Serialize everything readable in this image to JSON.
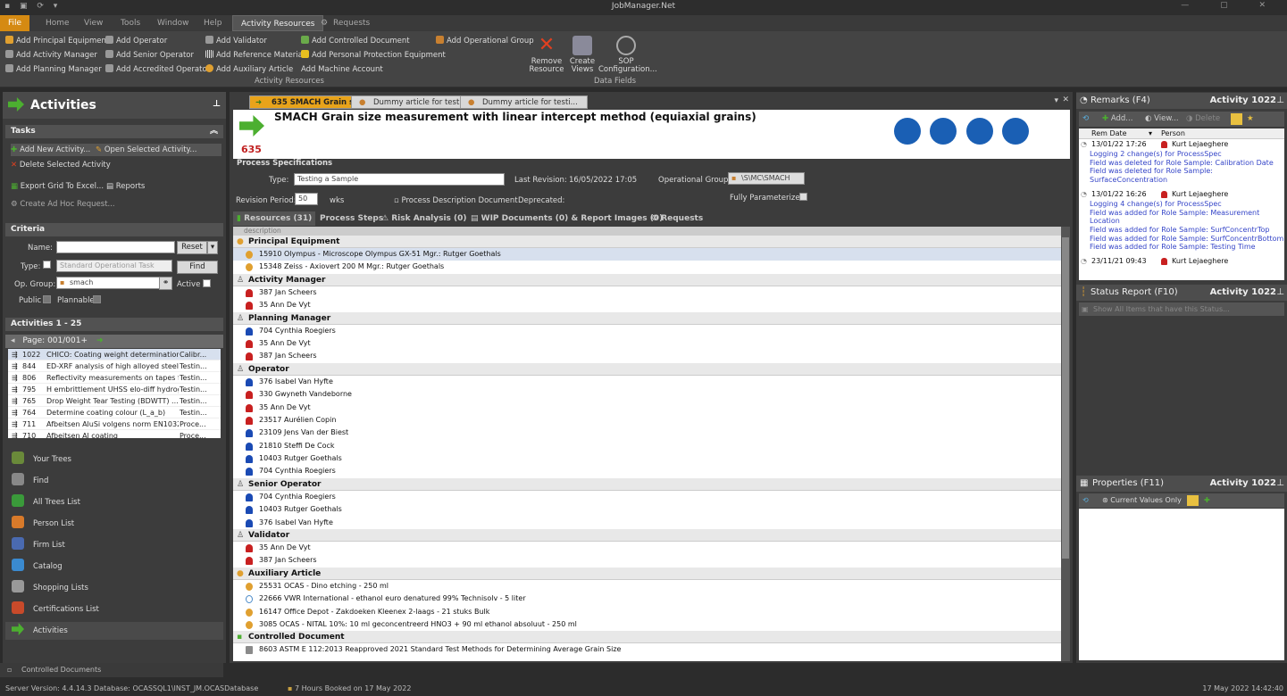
{
  "app": {
    "title": "JobManager.Net"
  },
  "menu": [
    "File",
    "Home",
    "View",
    "Tools",
    "Window",
    "Help",
    "Activity Resources",
    "Requests"
  ],
  "ribbon": {
    "col1": [
      "Add Principal Equipment",
      "Add Activity Manager",
      "Add Planning Manager"
    ],
    "col2": [
      "Add Operator",
      "Add Senior Operator",
      "Add Accredited Operator"
    ],
    "col3": [
      "Add Validator",
      "Add Reference Material",
      "Add Auxiliary Article"
    ],
    "col4": [
      "Add Controlled Document",
      "Add Personal Protection Equipment",
      "Add Machine Account"
    ],
    "col5": [
      "Add Operational Group"
    ],
    "remove": "Remove Resource",
    "create_views": "Create Views",
    "sop": "SOP Configuration...",
    "group_activity": "Activity Resources",
    "group_data": "Data Fields"
  },
  "left": {
    "title": "Activities",
    "tasks_label": "Tasks",
    "tasks": {
      "add_new": "Add New Activity...",
      "open_selected": "Open Selected Activity...",
      "delete_selected": "Delete Selected Activity",
      "export": "Export Grid To Excel...",
      "reports": "Reports",
      "create_adhoc": "Create Ad Hoc Request..."
    },
    "criteria_label": "Criteria",
    "criteria": {
      "name_label": "Name:",
      "reset": "Reset",
      "type_label": "Type:",
      "type_placeholder": "Standard Operational Task",
      "find": "Find",
      "opgroup_label": "Op. Group:",
      "opgroup_value": "smach",
      "active_label": "Active",
      "public_label": "Public",
      "plannable_label": "Plannable"
    },
    "activities_label": "Activities 1 - 25",
    "page": "Page: 001/001+",
    "activities": [
      {
        "id": "1022",
        "name": "CHICO: Coating weight determination ...",
        "type": "Calibr..."
      },
      {
        "id": "844",
        "name": "ED-XRF analysis of high alloyed steels",
        "type": "Testin..."
      },
      {
        "id": "806",
        "name": "Reflectivity measurements on tapes fr...",
        "type": "Testin..."
      },
      {
        "id": "795",
        "name": "H embrittlement UHSS elo-diff hydrog...",
        "type": "Testin..."
      },
      {
        "id": "765",
        "name": "Drop Weight Tear Testing (BDWTT) ...",
        "type": "Testin..."
      },
      {
        "id": "764",
        "name": "Determine coating colour (L_a_b)",
        "type": "Testin..."
      },
      {
        "id": "711",
        "name": "Afbeitsen AluSi volgens norm EN1032...",
        "type": "Proce..."
      },
      {
        "id": "710",
        "name": "Afbeitsen Al coating",
        "type": "Proce..."
      }
    ],
    "nav": [
      "Your Trees",
      "Find",
      "All Trees List",
      "Person List",
      "Firm List",
      "Catalog",
      "Shopping Lists",
      "Certifications List",
      "Activities"
    ]
  },
  "center": {
    "tabs": [
      "635 SMACH Grain si...",
      "Dummy article for testi...",
      "Dummy article for testi..."
    ],
    "doc_title": "SMACH Grain size measurement with linear intercept method (equiaxial grains)",
    "doc_id": "635",
    "process_specs": "Process Specifications",
    "type_label": "Type:",
    "type_value": "Testing a Sample",
    "last_revision_label": "Last Revision:",
    "last_revision_value": "16/05/2022 17:05",
    "opgroup_label": "Operational Group:",
    "opgroup_value": "\\S\\MC\\SMACH",
    "revision_period_label": "Revision Period:",
    "revision_period_value": "50",
    "wks": "wks",
    "process_desc": "Process Description Document",
    "deprecated": "Deprecated:",
    "fully_param": "Fully Parameterized:",
    "subtabs": [
      "Resources (31)",
      "Process Steps",
      "Risk Analysis (0)",
      "WIP Documents (0) & Report Images (0)",
      "Requests"
    ],
    "col_description": "description",
    "groups": [
      {
        "name": "Principal Equipment",
        "items": [
          "15910 Olympus - Microscope Olympus GX-51 Mgr.: Rutger Goethals",
          "15348 Zeiss - Axiovert 200 M Mgr.: Rutger Goethals"
        ]
      },
      {
        "name": "Activity Manager",
        "items": [
          "387 Jan Scheers",
          "35 Ann De Vyt"
        ]
      },
      {
        "name": "Planning Manager",
        "items": [
          "704 Cynthia Roegiers",
          "35 Ann De Vyt",
          "387 Jan Scheers"
        ]
      },
      {
        "name": "Operator",
        "items": [
          "376 Isabel Van Hyfte",
          "330 Gwyneth Vandeborne",
          "35 Ann De Vyt",
          "23517 Aurélien Copin",
          "23109 Jens Van der Biest",
          "21810 Steffi De Cock",
          "10403 Rutger Goethals",
          "704 Cynthia Roegiers"
        ]
      },
      {
        "name": "Senior Operator",
        "items": [
          "704 Cynthia Roegiers",
          "10403 Rutger Goethals",
          "376 Isabel Van Hyfte"
        ]
      },
      {
        "name": "Validator",
        "items": [
          "35 Ann De Vyt",
          "387 Jan Scheers"
        ]
      },
      {
        "name": "Auxiliary Article",
        "items": [
          "25531 OCAS - Dino etching - 250 ml",
          "22666 VWR International - ethanol euro denatured 99% Technisolv - 5 liter",
          "16147 Office Depot - Zakdoeken Kleenex 2-laags - 21 stuks Bulk",
          "3085 OCAS - NITAL 10%: 10 ml geconcentreerd HNO3 + 90 ml ethanol absoluut - 250 ml"
        ]
      },
      {
        "name": "Controlled Document",
        "items": [
          "8603 ASTM E 112:2013 Reapproved 2021 Standard Test Methods for Determining Average Grain Size"
        ]
      }
    ]
  },
  "right": {
    "remarks_title": "Remarks (F4)",
    "activity_label": "Activity 1022",
    "add": "Add...",
    "view": "View...",
    "delete": "Delete",
    "col_remdate": "Rem Date",
    "col_person": "Person",
    "remarks": [
      {
        "date": "13/01/22 17:26",
        "person": "Kurt Lejaeghere",
        "lines": [
          "Logging 2 change(s) for ProcessSpec",
          "Field was deleted for Role Sample: Calibration Date",
          "Field was deleted for Role Sample:",
          "SurfaceConcentration"
        ]
      },
      {
        "date": "13/01/22 16:26",
        "person": "Kurt Lejaeghere",
        "lines": [
          "Logging 4 change(s) for ProcessSpec",
          "Field was added for Role Sample: Measurement",
          "Location",
          "Field was added for Role Sample: SurfConcentrTop",
          "Field was added for Role Sample: SurfConcentrBottom",
          "Field was added for Role Sample: Testing Time"
        ]
      },
      {
        "date": "23/11/21 09:43",
        "person": "Kurt Lejaeghere",
        "lines": []
      }
    ],
    "status_title": "Status Report (F10)",
    "status_show_all": "Show All Items that have this Status...",
    "properties_title": "Properties (F11)",
    "current_values": "Current Values Only"
  },
  "status": {
    "controlled_docs": "Controlled Documents",
    "server": "Server Version: 4.4.14.3 Database: OCASSQL1\\INST_JM.OCASDatabase",
    "hours": "7 Hours Booked on 17 May 2022",
    "datetime": "17 May 2022 14:42:40"
  },
  "colors": {
    "accent": "#d58a12",
    "remark_blue": "#3545c8",
    "header_bg": "#4a4a4a"
  }
}
